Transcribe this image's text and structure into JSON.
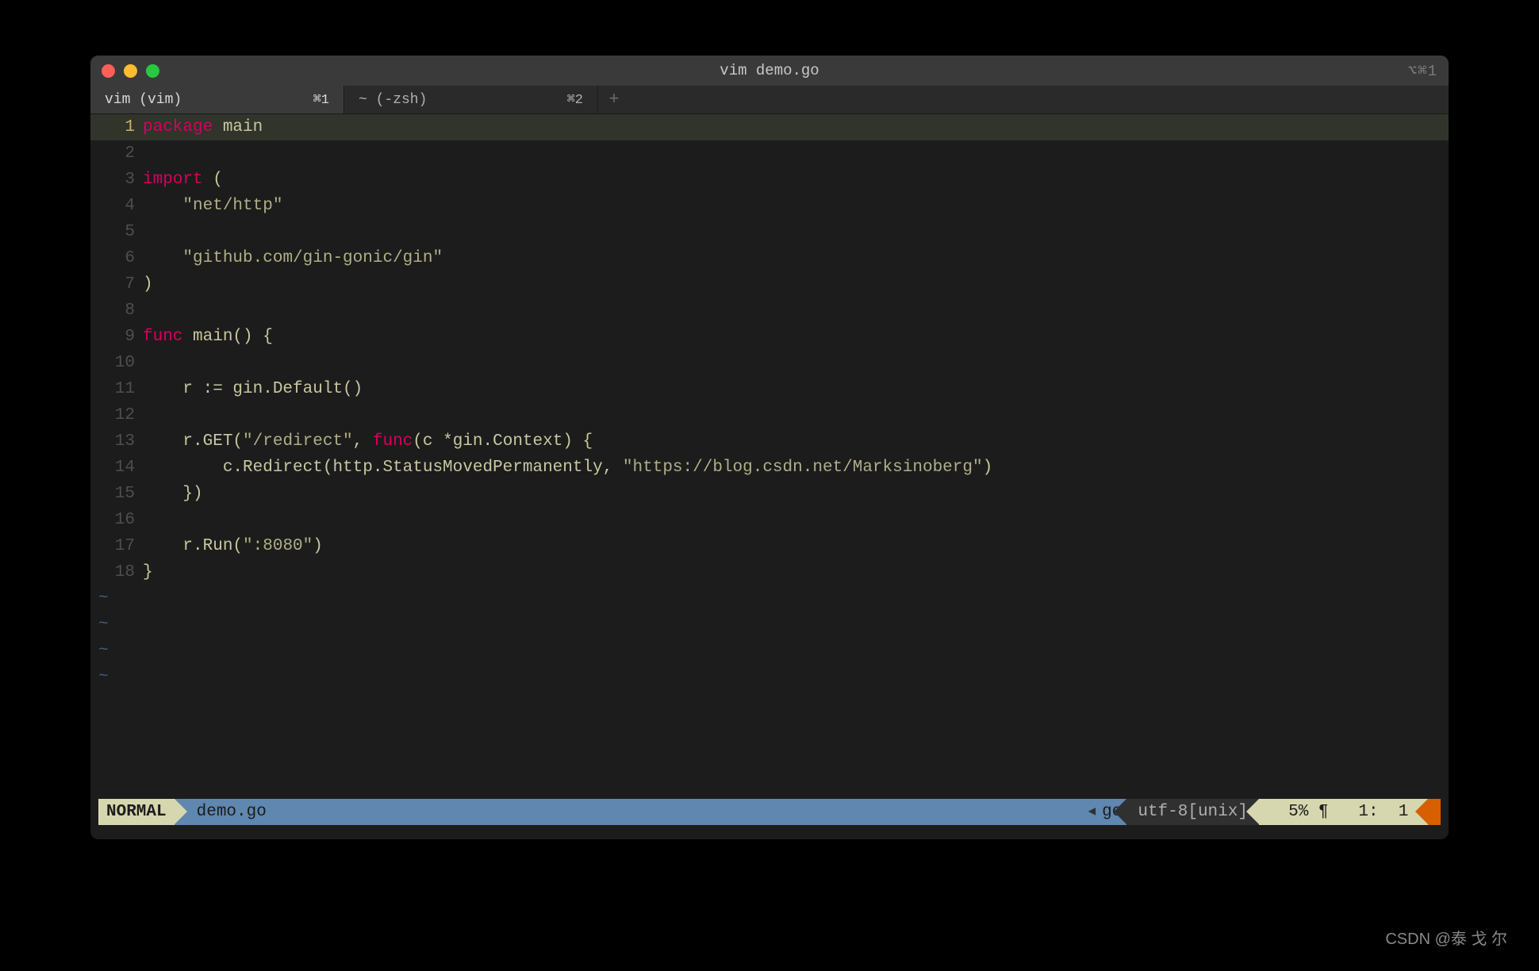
{
  "window": {
    "title": "vim demo.go",
    "right_shortcut": "⌥⌘1"
  },
  "tabs": [
    {
      "label": "vim (vim)",
      "shortcut": "⌘1",
      "active": true
    },
    {
      "label": "~ (-zsh)",
      "shortcut": "⌘2",
      "active": false
    }
  ],
  "code_lines": [
    {
      "n": 1,
      "current": true,
      "segs": [
        {
          "t": "package",
          "c": "kw"
        },
        {
          "t": " ",
          "c": "plain"
        },
        {
          "t": "main",
          "c": "id"
        }
      ]
    },
    {
      "n": 2,
      "current": false,
      "segs": []
    },
    {
      "n": 3,
      "current": false,
      "segs": [
        {
          "t": "import",
          "c": "kw"
        },
        {
          "t": " (",
          "c": "plain"
        }
      ]
    },
    {
      "n": 4,
      "current": false,
      "segs": [
        {
          "t": "    ",
          "c": "plain"
        },
        {
          "t": "\"net/http\"",
          "c": "str"
        }
      ]
    },
    {
      "n": 5,
      "current": false,
      "segs": []
    },
    {
      "n": 6,
      "current": false,
      "segs": [
        {
          "t": "    ",
          "c": "plain"
        },
        {
          "t": "\"github.com/gin-gonic/gin\"",
          "c": "str"
        }
      ]
    },
    {
      "n": 7,
      "current": false,
      "segs": [
        {
          "t": ")",
          "c": "plain"
        }
      ]
    },
    {
      "n": 8,
      "current": false,
      "segs": []
    },
    {
      "n": 9,
      "current": false,
      "segs": [
        {
          "t": "func",
          "c": "kw"
        },
        {
          "t": " main() {",
          "c": "plain"
        }
      ]
    },
    {
      "n": 10,
      "current": false,
      "segs": []
    },
    {
      "n": 11,
      "current": false,
      "segs": [
        {
          "t": "    r := gin.Default()",
          "c": "plain"
        }
      ]
    },
    {
      "n": 12,
      "current": false,
      "segs": []
    },
    {
      "n": 13,
      "current": false,
      "segs": [
        {
          "t": "    r.GET(",
          "c": "plain"
        },
        {
          "t": "\"/redirect\"",
          "c": "str"
        },
        {
          "t": ", ",
          "c": "plain"
        },
        {
          "t": "func",
          "c": "kw2"
        },
        {
          "t": "(c *gin.Context) {",
          "c": "plain"
        }
      ]
    },
    {
      "n": 14,
      "current": false,
      "segs": [
        {
          "t": "        c.Redirect(http.StatusMovedPermanently, ",
          "c": "plain"
        },
        {
          "t": "\"https://blog.csdn.net/Marksinoberg\"",
          "c": "str"
        },
        {
          "t": ")",
          "c": "plain"
        }
      ]
    },
    {
      "n": 15,
      "current": false,
      "segs": [
        {
          "t": "    })",
          "c": "plain"
        }
      ]
    },
    {
      "n": 16,
      "current": false,
      "segs": []
    },
    {
      "n": 17,
      "current": false,
      "segs": [
        {
          "t": "    r.Run(",
          "c": "plain"
        },
        {
          "t": "\":8080\"",
          "c": "str"
        },
        {
          "t": ")",
          "c": "plain"
        }
      ]
    },
    {
      "n": 18,
      "current": false,
      "segs": [
        {
          "t": "}",
          "c": "plain"
        }
      ]
    }
  ],
  "tilde_count": 4,
  "status": {
    "mode": "NORMAL",
    "filename": "demo.go",
    "filetype": "go",
    "encoding": "utf-8[unix]",
    "percent": "5%",
    "pilcrow": "¶",
    "line": "1",
    "col": "1"
  },
  "watermark": "CSDN @泰 戈 尔"
}
